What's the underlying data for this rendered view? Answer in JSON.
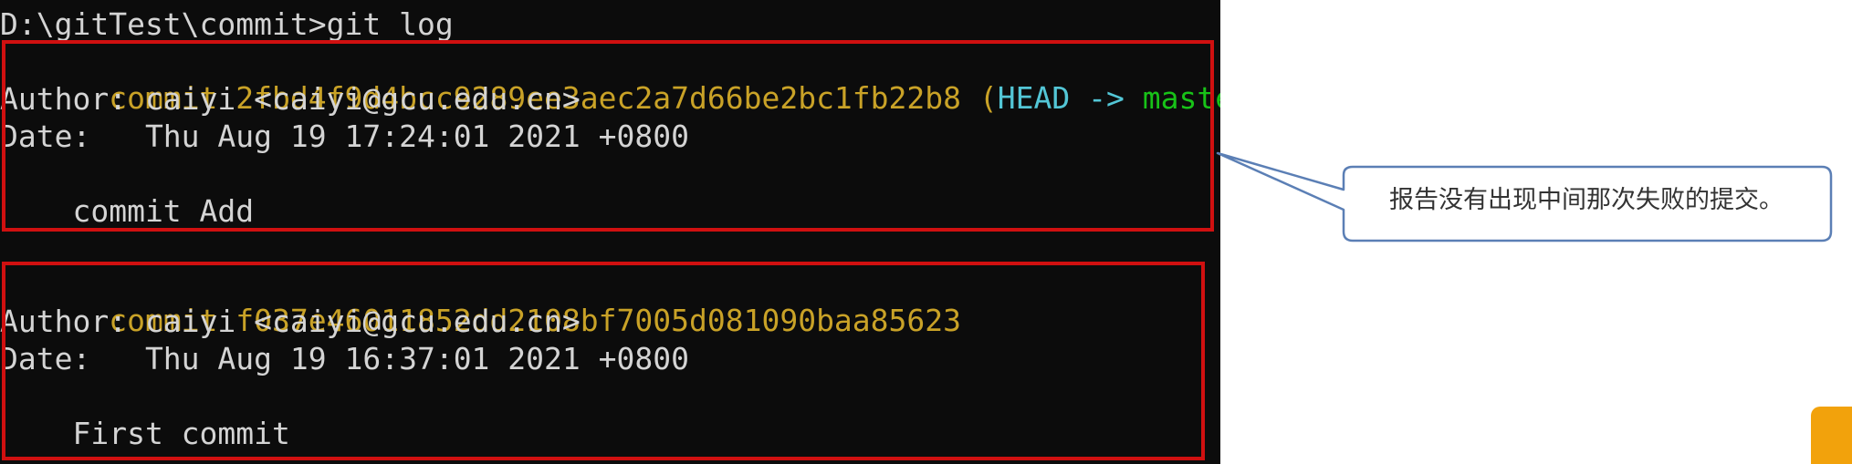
{
  "terminal": {
    "prompt_line": "D:\\gitTest\\commit>git log",
    "commits": [
      {
        "commit_prefix": "commit ",
        "hash": "2fbd4f9d4bcc9289ee3aec2a7d66be2bc1fb22b8",
        "ref_open": " (",
        "ref_head": "HEAD -> ",
        "ref_branch": "master",
        "ref_close": ")",
        "author_line": "Author: caiyi <caiyi@gcu.edu.cn>",
        "date_line": "Date:   Thu Aug 19 17:24:01 2021 +0800",
        "message": "    commit Add"
      },
      {
        "commit_prefix": "commit ",
        "hash": "f037e46011852dd2108bf7005d081090baa85623",
        "author_line": "Author: caiyi <caiyi@gcu.edu.cn>",
        "date_line": "Date:   Thu Aug 19 16:37:01 2021 +0800",
        "message": "    First commit"
      }
    ]
  },
  "callout": {
    "text": "报告没有出现中间那次失败的提交。"
  },
  "colors": {
    "terminal_bg": "#0c0c0c",
    "commit_yellow": "#c9a227",
    "head_cyan": "#53c6d6",
    "branch_green": "#18c218",
    "highlight_red": "#d01010",
    "callout_border": "#5b7fb5",
    "accent_orange": "#f2a20c"
  }
}
